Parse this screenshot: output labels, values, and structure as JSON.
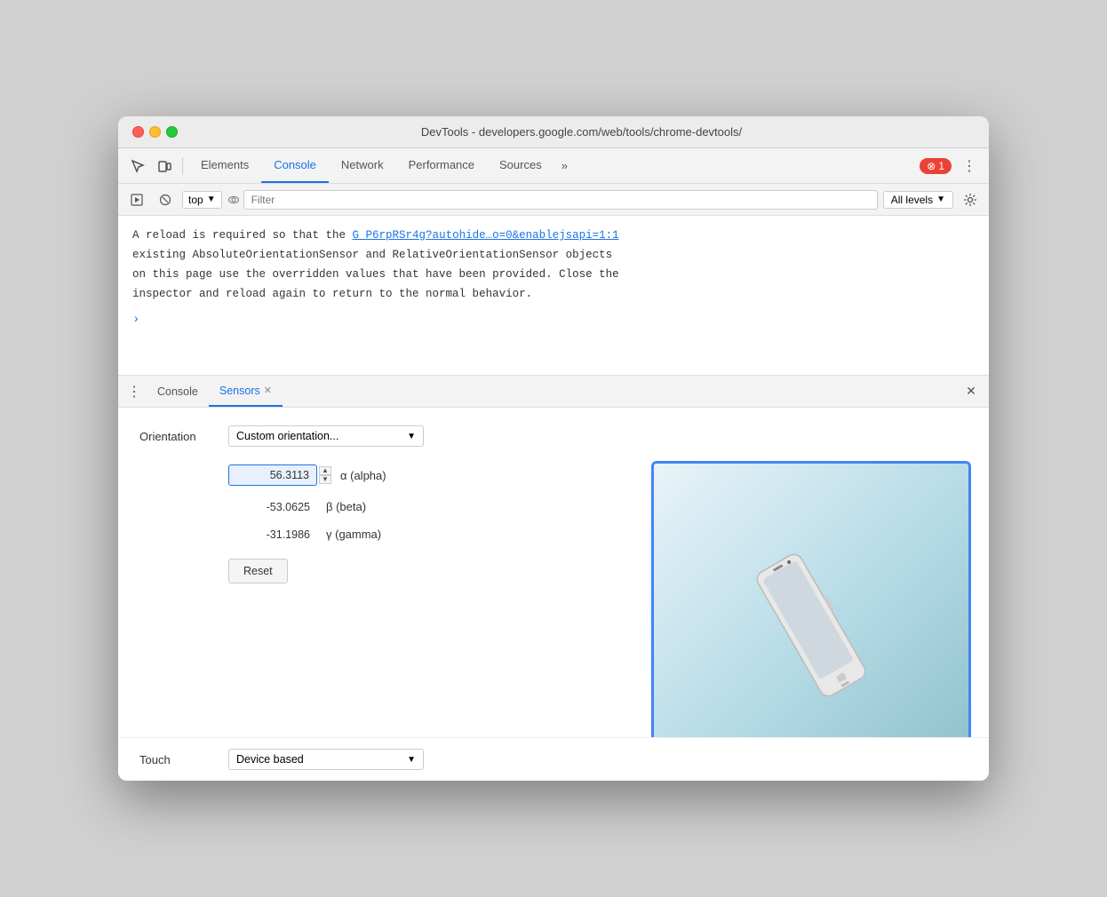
{
  "window": {
    "title": "DevTools - developers.google.com/web/tools/chrome-devtools/"
  },
  "tabs": {
    "items": [
      {
        "label": "Elements",
        "active": false
      },
      {
        "label": "Console",
        "active": true
      },
      {
        "label": "Network",
        "active": false
      },
      {
        "label": "Performance",
        "active": false
      },
      {
        "label": "Sources",
        "active": false
      }
    ],
    "more_label": "»",
    "error_count": "1"
  },
  "console_toolbar": {
    "context_label": "top",
    "filter_placeholder": "Filter",
    "levels_label": "All levels"
  },
  "console_output": {
    "message": "A reload is required so that the ",
    "link_text": "G_P6rpRSr4g?autohide…o=0&enablejsapi=1:1",
    "message2": "existing AbsoluteOrientationSensor and RelativeOrientationSensor objects",
    "message3": "on this page use the overridden values that have been provided. Close the",
    "message4": "inspector and reload again to return to the normal behavior."
  },
  "bottom_panel": {
    "dots_label": "⋮",
    "tab_console": "Console",
    "tab_sensors": "Sensors",
    "close_label": "✕"
  },
  "sensors": {
    "orientation_label": "Orientation",
    "orientation_value": "Custom orientation...",
    "alpha_value": "56.3113",
    "alpha_label": "α (alpha)",
    "beta_value": "-53.0625",
    "beta_label": "β (beta)",
    "gamma_value": "-31.1986",
    "gamma_label": "γ (gamma)",
    "reset_label": "Reset",
    "touch_label": "Touch",
    "touch_value": "Device based"
  }
}
